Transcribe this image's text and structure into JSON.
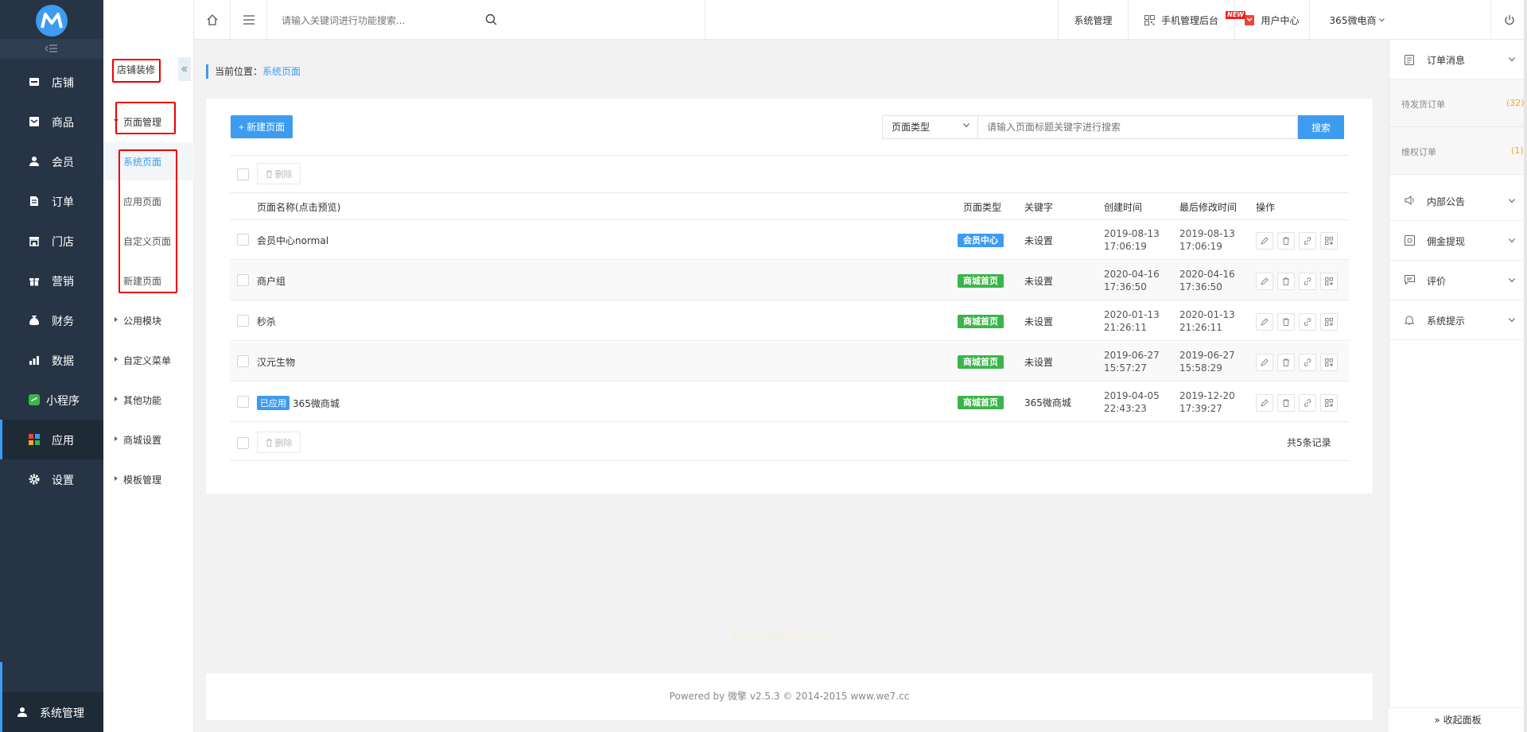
{
  "nav": {
    "logo_letter": "M",
    "items": [
      {
        "label": "店铺",
        "icon": "store-icon"
      },
      {
        "label": "商品",
        "icon": "goods-icon"
      },
      {
        "label": "会员",
        "icon": "user-icon"
      },
      {
        "label": "订单",
        "icon": "order-icon"
      },
      {
        "label": "门店",
        "icon": "shop-icon"
      },
      {
        "label": "营销",
        "icon": "gift-icon"
      },
      {
        "label": "财务",
        "icon": "moneybag-icon"
      },
      {
        "label": "数据",
        "icon": "bar-chart-icon"
      },
      {
        "label": "小程序",
        "icon": "miniprogram-icon"
      },
      {
        "label": "应用",
        "icon": "apps-icon"
      },
      {
        "label": "设置",
        "icon": "gear-icon"
      }
    ],
    "active_item": "应用",
    "system_label": "系统管理"
  },
  "subnav": {
    "title": "店铺装修",
    "page_group_label": "页面管理",
    "page_items": [
      {
        "label": "系统页面",
        "active": true
      },
      {
        "label": "应用页面",
        "active": false
      },
      {
        "label": "自定义页面",
        "active": false
      },
      {
        "label": "新建页面",
        "active": false
      }
    ],
    "other_groups": [
      "公用模块",
      "自定义菜单",
      "其他功能",
      "商城设置",
      "模板管理"
    ]
  },
  "topbar": {
    "search_placeholder": "请输入关键词进行功能搜索...",
    "system_manage": "系统管理",
    "mobile_backend": "手机管理后台",
    "new_badge": "NEW",
    "user_center": "用户中心",
    "shop_name": "365微电商"
  },
  "breadcrumb": {
    "label": "当前位置：",
    "current": "系统页面"
  },
  "toolbar": {
    "new_page_label": "+ 新建页面",
    "type_select_value": "页面类型",
    "keyword_placeholder": "请输入页面标题关键字进行搜索",
    "search_label": "搜索",
    "delete_label": "删除"
  },
  "table": {
    "headers": [
      "页面名称(点击预览)",
      "页面类型",
      "关键字",
      "创建时间",
      "最后修改时间",
      "操作"
    ],
    "rows": [
      {
        "name": "会员中心normal",
        "applied": "",
        "type": "会员中心",
        "type_color": "#3d9bf0",
        "keyword": "未设置",
        "created_date": "2019-08-13",
        "created_time": "17:06:19",
        "modified_date": "2019-08-13",
        "modified_time": "17:06:19"
      },
      {
        "name": "商户组",
        "applied": "",
        "type": "商城首页",
        "type_color": "#3ab54a",
        "keyword": "未设置",
        "created_date": "2020-04-16",
        "created_time": "17:36:50",
        "modified_date": "2020-04-16",
        "modified_time": "17:36:50"
      },
      {
        "name": "秒杀",
        "applied": "",
        "type": "商城首页",
        "type_color": "#3ab54a",
        "keyword": "未设置",
        "created_date": "2020-01-13",
        "created_time": "21:26:11",
        "modified_date": "2020-01-13",
        "modified_time": "21:26:11"
      },
      {
        "name": "汉元生物",
        "applied": "",
        "type": "商城首页",
        "type_color": "#3ab54a",
        "keyword": "未设置",
        "created_date": "2019-06-27",
        "created_time": "15:57:27",
        "modified_date": "2019-06-27",
        "modified_time": "15:58:29"
      },
      {
        "name": "365微商城",
        "applied": "已应用",
        "type": "商城首页",
        "type_color": "#3ab54a",
        "keyword": "365微商城",
        "created_date": "2019-04-05",
        "created_time": "22:43:23",
        "modified_date": "2019-12-20",
        "modified_time": "17:39:27"
      }
    ],
    "total": "共5条记录"
  },
  "tech_support": "未多微商城提供技术支持",
  "footer": "Powered by 微擎 v2.5.3 © 2014-2015 www.we7.cc",
  "right_panel": {
    "order_msg": "订单消息",
    "pending_label": "待发货订单",
    "pending_count": "(32)",
    "rights_label": "维权订单",
    "rights_count": "(1)",
    "notice": "内部公告",
    "commission": "佣金提现",
    "review": "评价",
    "system_tip": "系统提示",
    "collapse": "» 收起面板"
  },
  "colors": {
    "accent": "#3d9bf0",
    "nav_bg": "#263445",
    "green_tag": "#3ab54a",
    "orange": "#f5a623",
    "highlight_box": "#ee0000"
  }
}
